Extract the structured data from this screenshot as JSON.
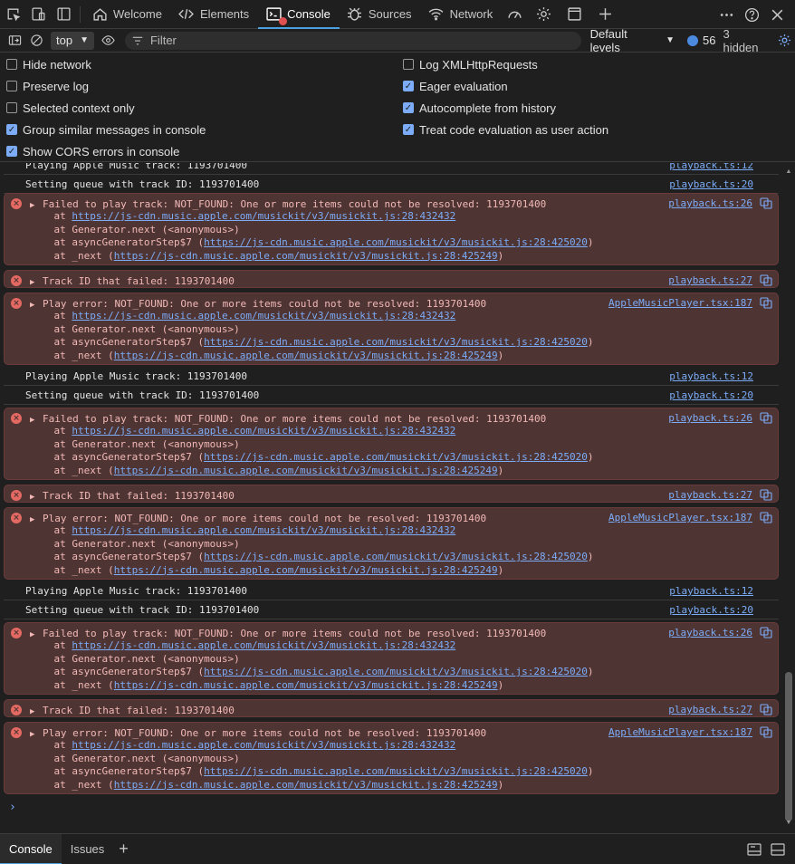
{
  "tabs": [
    {
      "label": "Welcome",
      "icon": "home-icon"
    },
    {
      "label": "Elements",
      "icon": "code-icon"
    },
    {
      "label": "Console",
      "icon": "console-icon",
      "active": true
    },
    {
      "label": "Sources",
      "icon": "bug-icon"
    },
    {
      "label": "Network",
      "icon": "wifi-icon"
    }
  ],
  "toolbar": {
    "context": "top",
    "filter_placeholder": "Filter",
    "levels": "Default levels",
    "message_count": "56",
    "hidden": "3 hidden"
  },
  "settings": {
    "left": [
      {
        "label": "Hide network",
        "checked": false
      },
      {
        "label": "Preserve log",
        "checked": false
      },
      {
        "label": "Selected context only",
        "checked": false
      },
      {
        "label": "Group similar messages in console",
        "checked": true
      },
      {
        "label": "Show CORS errors in console",
        "checked": true
      }
    ],
    "right": [
      {
        "label": "Log XMLHttpRequests",
        "checked": false
      },
      {
        "label": "Eager evaluation",
        "checked": true
      },
      {
        "label": "Autocomplete from history",
        "checked": true
      },
      {
        "label": "Treat code evaluation as user action",
        "checked": true
      }
    ]
  },
  "console": {
    "messages": [
      {
        "type": "info",
        "text": "Playing Apple Music track: 1193701400",
        "source": "playback.ts:12"
      },
      {
        "type": "info",
        "text": "Setting queue with track ID: 1193701400",
        "source": "playback.ts:20"
      },
      {
        "type": "error",
        "text": "Failed to play track: NOT_FOUND: One or more items could not be resolved: 1193701400",
        "source": "playback.ts:26",
        "stack": true
      },
      {
        "type": "error",
        "text": "Track ID that failed: 1193701400",
        "source": "playback.ts:27",
        "stack": false
      },
      {
        "type": "error",
        "text": "Play error: NOT_FOUND: One or more items could not be resolved: 1193701400",
        "source": "AppleMusicPlayer.tsx:187",
        "stack": true
      },
      {
        "type": "info",
        "text": "Playing Apple Music track: 1193701400",
        "source": "playback.ts:12"
      },
      {
        "type": "info",
        "text": "Setting queue with track ID: 1193701400",
        "source": "playback.ts:20"
      },
      {
        "type": "error",
        "text": "Failed to play track: NOT_FOUND: One or more items could not be resolved: 1193701400",
        "source": "playback.ts:26",
        "stack": true
      },
      {
        "type": "error",
        "text": "Track ID that failed: 1193701400",
        "source": "playback.ts:27",
        "stack": false
      },
      {
        "type": "error",
        "text": "Play error: NOT_FOUND: One or more items could not be resolved: 1193701400",
        "source": "AppleMusicPlayer.tsx:187",
        "stack": true
      },
      {
        "type": "info",
        "text": "Playing Apple Music track: 1193701400",
        "source": "playback.ts:12"
      },
      {
        "type": "info",
        "text": "Setting queue with track ID: 1193701400",
        "source": "playback.ts:20"
      },
      {
        "type": "error",
        "text": "Failed to play track: NOT_FOUND: One or more items could not be resolved: 1193701400",
        "source": "playback.ts:26",
        "stack": true
      },
      {
        "type": "error",
        "text": "Track ID that failed: 1193701400",
        "source": "playback.ts:27",
        "stack": false
      },
      {
        "type": "error",
        "text": "Play error: NOT_FOUND: One or more items could not be resolved: 1193701400",
        "source": "AppleMusicPlayer.tsx:187",
        "stack": true
      }
    ],
    "stack_lines": [
      {
        "prefix": "at ",
        "link": "https://js-cdn.music.apple.com/musickit/v3/musickit.js:28:432432",
        "suffix": ""
      },
      {
        "prefix": "at Generator.next (<anonymous>)",
        "link": "",
        "suffix": ""
      },
      {
        "prefix": "at asyncGeneratorStep$7 (",
        "link": "https://js-cdn.music.apple.com/musickit/v3/musickit.js:28:425020",
        "suffix": ")"
      },
      {
        "prefix": "at _next (",
        "link": "https://js-cdn.music.apple.com/musickit/v3/musickit.js:28:425249",
        "suffix": ")"
      }
    ],
    "prompt": "›"
  },
  "drawer": {
    "tabs": [
      {
        "label": "Console",
        "active": true
      },
      {
        "label": "Issues",
        "active": false
      }
    ],
    "add": "+"
  }
}
